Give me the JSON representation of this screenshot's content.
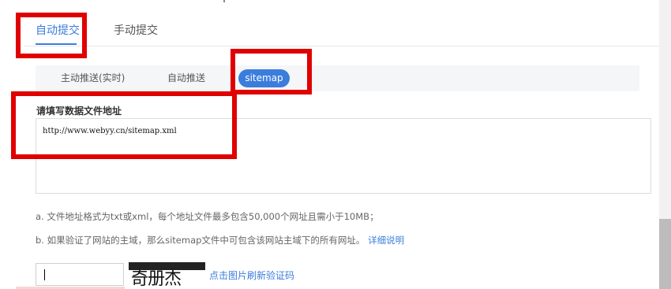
{
  "tabs": {
    "auto_submit": "自动提交",
    "manual_submit": "手动提交"
  },
  "subtabs": {
    "active_push": "主动推送(实时)",
    "auto_push": "自动推送",
    "sitemap": "sitemap"
  },
  "form": {
    "label": "请填写数据文件地址",
    "url_value": "http://www.webyy.cn/sitemap.xml"
  },
  "notes": {
    "a": "a. 文件地址格式为txt或xml，每个地址文件最多包含50,000个网址且需小于10MB；",
    "b_text": "b. 如果验证了网站的主域，那么sitemap文件中可包含该网站主域下的所有网址。",
    "b_link": "详细说明"
  },
  "captcha": {
    "input_value": "",
    "image_text": "奇册杰",
    "refresh_label": "点击图片刷新验证码"
  },
  "colors": {
    "accent": "#3b7ddd",
    "highlight": "#e00000"
  }
}
